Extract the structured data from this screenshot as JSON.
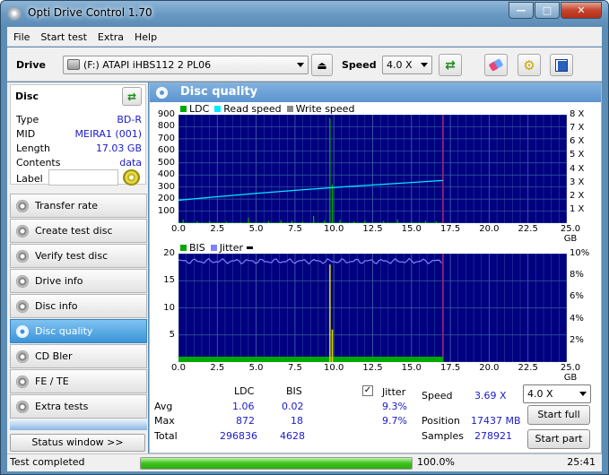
{
  "window": {
    "title": "Opti Drive Control 1.70",
    "min": "—",
    "max": "□",
    "close": "✕"
  },
  "menu": [
    "File",
    "Start test",
    "Extra",
    "Help"
  ],
  "toolbar": {
    "drive_label": "Drive",
    "drive_value": "(F:)   ATAPI iHBS112   2 PL06",
    "speed_label": "Speed",
    "speed_value": "4.0 X"
  },
  "disc": {
    "header": "Disc",
    "rows": [
      {
        "k": "Type",
        "v": "BD-R"
      },
      {
        "k": "MID",
        "v": "MEIRA1 (001)"
      },
      {
        "k": "Length",
        "v": "17.03 GB"
      },
      {
        "k": "Contents",
        "v": "data"
      }
    ],
    "label_key": "Label",
    "label_value": ""
  },
  "nav": [
    {
      "label": "Transfer rate",
      "active": false
    },
    {
      "label": "Create test disc",
      "active": false
    },
    {
      "label": "Verify test disc",
      "active": false
    },
    {
      "label": "Drive info",
      "active": false
    },
    {
      "label": "Disc info",
      "active": false
    },
    {
      "label": "Disc quality",
      "active": true
    },
    {
      "label": "CD Bler",
      "active": false
    },
    {
      "label": "FE / TE",
      "active": false
    },
    {
      "label": "Extra tests",
      "active": false
    }
  ],
  "status_window_button": "Status window >>",
  "panel_title": "Disc quality",
  "colors": {
    "ldc": "#00a800",
    "read_speed": "#00e8ff",
    "write_speed": "#888888",
    "bis": "#00a800",
    "jitter": "#8080ff",
    "chart_bg": "#000080",
    "grid": "#3a5fa0",
    "accent": "#3a94d8"
  },
  "chart_data": [
    {
      "type": "bar",
      "legend": [
        "LDC",
        "Read speed",
        "Write speed"
      ],
      "x_ticks": [
        "0.0",
        "2.5",
        "5.0",
        "7.5",
        "10.0",
        "12.5",
        "15.0",
        "17.5",
        "20.0",
        "22.5",
        "25.0 GB"
      ],
      "y_ticks": [
        "900",
        "800",
        "700",
        "600",
        "500",
        "400",
        "300",
        "200",
        "100"
      ],
      "y2_ticks": [
        "8 X",
        "7 X",
        "6 X",
        "5 X",
        "4 X",
        "3 X",
        "2 X",
        "1 X"
      ],
      "xlim": [
        0,
        25
      ],
      "ylim": [
        0,
        900
      ],
      "y2lim": [
        0,
        8
      ],
      "data_end": 17.03,
      "ldc_spikes": [
        [
          0.3,
          30
        ],
        [
          1.2,
          15
        ],
        [
          2.0,
          20
        ],
        [
          3.1,
          12
        ],
        [
          4.5,
          45
        ],
        [
          5.8,
          18
        ],
        [
          6.6,
          25
        ],
        [
          7.3,
          20
        ],
        [
          8.0,
          12
        ],
        [
          8.7,
          60
        ],
        [
          9.4,
          22
        ],
        [
          9.75,
          872
        ],
        [
          9.9,
          320
        ],
        [
          10.4,
          28
        ],
        [
          11.3,
          15
        ],
        [
          12.0,
          22
        ],
        [
          13.2,
          18
        ],
        [
          14.1,
          30
        ],
        [
          15.0,
          14
        ],
        [
          15.9,
          20
        ],
        [
          16.6,
          16
        ]
      ],
      "read_speed": [
        [
          0,
          1.69
        ],
        [
          2.5,
          1.95
        ],
        [
          5.0,
          2.2
        ],
        [
          7.5,
          2.42
        ],
        [
          10.0,
          2.63
        ],
        [
          12.5,
          2.82
        ],
        [
          15.0,
          3.0
        ],
        [
          17.03,
          3.15
        ]
      ]
    },
    {
      "type": "bar",
      "legend": [
        "BIS",
        "Jitter"
      ],
      "x_ticks": [
        "0.0",
        "2.5",
        "5.0",
        "7.5",
        "10.0",
        "12.5",
        "15.0",
        "17.5",
        "20.0",
        "22.5",
        "25.0 GB"
      ],
      "y_ticks": [
        "20",
        "15",
        "10",
        "5"
      ],
      "y2_ticks": [
        "10%",
        "8%",
        "6%",
        "4%",
        "2%"
      ],
      "xlim": [
        0,
        25
      ],
      "ylim": [
        0,
        20
      ],
      "y2lim": [
        0,
        10
      ],
      "data_end": 17.03,
      "bis_spikes": [
        [
          9.75,
          18
        ],
        [
          9.9,
          6
        ]
      ],
      "bis_base": 1,
      "jitter": [
        [
          0,
          9.4
        ],
        [
          2.5,
          9.3
        ],
        [
          5.0,
          9.35
        ],
        [
          7.5,
          9.3
        ],
        [
          10.0,
          9.4
        ],
        [
          12.5,
          9.3
        ],
        [
          15.0,
          9.3
        ],
        [
          17.03,
          9.25
        ]
      ]
    }
  ],
  "stats": {
    "col_ldc": "LDC",
    "col_bis": "BIS",
    "col_jitter": "Jitter",
    "avg_label": "Avg",
    "max_label": "Max",
    "total_label": "Total",
    "avg_ldc": "1.06",
    "avg_bis": "0.02",
    "avg_jitter": "9.3%",
    "max_ldc": "872",
    "max_bis": "18",
    "max_jitter": "9.7%",
    "total_ldc": "296836",
    "total_bis": "4628",
    "speed_label": "Speed",
    "speed_value": "3.69 X",
    "position_label": "Position",
    "position_value": "17437 MB",
    "samples_label": "Samples",
    "samples_value": "278921",
    "speed_select": "4.0 X",
    "start_full": "Start full",
    "start_part": "Start part"
  },
  "status": {
    "text": "Test completed",
    "progress": 100,
    "progress_text": "100.0%",
    "time": "25:41"
  }
}
